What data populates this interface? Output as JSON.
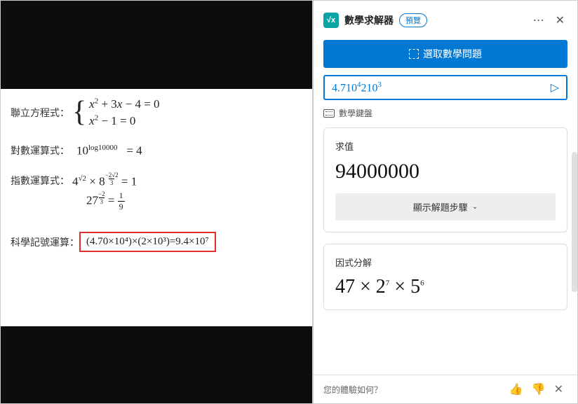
{
  "left": {
    "row1_label": "聯立方程式：",
    "row1_eq1_a": "x",
    "row1_eq1_b": " + 3",
    "row1_eq1_c": "x",
    "row1_eq1_d": " − 4 = 0",
    "row1_eq2_a": "x",
    "row1_eq2_b": " − 1 = 0",
    "row2_label": "對數運算式：",
    "row2_body": "10",
    "row2_sup": "log10000",
    "row2_tail": " = 4",
    "row3_label": "指數運算式：",
    "row3_a": "4",
    "row3_a_sup": "√2",
    "row3_mul": " × 8",
    "row3_b_sup_num": "−2√2",
    "row3_b_sup_den": "3",
    "row3_tail": " = 1",
    "row3b_a": "27",
    "row3b_sup_num": "−2",
    "row3b_sup_den": "3",
    "row3b_eq": " = ",
    "row3b_frac_num": "1",
    "row3b_frac_den": "9",
    "row4_label": "科學記號運算：",
    "row4_body": "(4.70×10⁴)×(2×10³)=9.4×10⁷"
  },
  "panel": {
    "title": "數學求解器",
    "preview": "預覽",
    "select_button": "選取數學問題",
    "input_plain": "4.710",
    "input_sup1": "4",
    "input_mid": "210",
    "input_sup2": "3",
    "keyboard": "數學鍵盤",
    "card1_label": "求值",
    "card1_result": "94000000",
    "steps_button": "顯示解題步驟",
    "card2_label": "因式分解",
    "factor_a": "47 × 2",
    "factor_sup1": "7",
    "factor_b": " × 5",
    "factor_sup2": "6",
    "footer_question": "您的體驗如何？"
  }
}
